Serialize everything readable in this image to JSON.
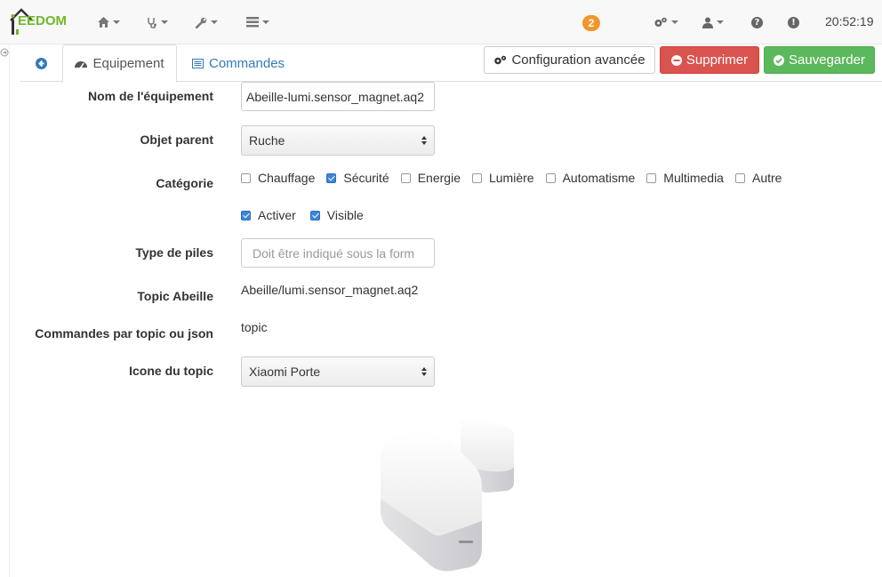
{
  "navbar": {
    "logo_text": "EEDOM",
    "badge_count": "2",
    "clock": "20:52:19",
    "icons": [
      "home-icon",
      "stethoscope-icon",
      "wrench-icon",
      "list-icon",
      "cogs-icon",
      "user-icon",
      "question-icon",
      "exclamation-icon"
    ]
  },
  "tabs": {
    "back_icon": "arrow-circle-left-icon",
    "equipement": "Equipement",
    "commandes": "Commandes"
  },
  "actions": {
    "config": "Configuration avancée",
    "delete": "Supprimer",
    "save": "Sauvegarder"
  },
  "form": {
    "name_label": "Nom de l'équipement",
    "name_value": "Abeille-lumi.sensor_magnet.aq2",
    "parent_label": "Objet parent",
    "parent_value": "Ruche",
    "category_label": "Catégorie",
    "categories": [
      {
        "label": "Chauffage",
        "checked": false
      },
      {
        "label": "Sécurité",
        "checked": true
      },
      {
        "label": "Energie",
        "checked": false
      },
      {
        "label": "Lumière",
        "checked": false
      },
      {
        "label": "Automatisme",
        "checked": false
      },
      {
        "label": "Multimedia",
        "checked": false
      },
      {
        "label": "Autre",
        "checked": false
      }
    ],
    "activate_label": "Activer",
    "visible_label": "Visible",
    "battery_label": "Type de piles",
    "battery_placeholder": "Doit être indiqué sous la form",
    "topic_label": "Topic Abeille",
    "topic_value": "Abeille/lumi.sensor_magnet.aq2",
    "cmd_label": "Commandes par topic ou json",
    "cmd_value": "topic",
    "icon_label": "Icone du topic",
    "icon_value": "Xiaomi Porte"
  },
  "colors": {
    "accent": "#337ab7",
    "danger": "#d9534f",
    "success": "#5cb85c",
    "badge": "#f0962b",
    "logo": "#6fb82b"
  }
}
